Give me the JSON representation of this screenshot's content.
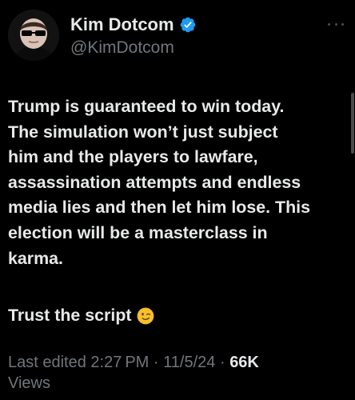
{
  "author": {
    "display_name": "Kim Dotcom",
    "handle": "@KimDotcom",
    "verified": true,
    "verified_color": "#1d9bf0"
  },
  "tweet": {
    "text": "Trump is guaranteed to win today.\nThe simulation won’t just subject\nhim and the players to lawfare,\nassassination attempts and endless\nmedia lies and then let him lose. This\nelection will be a masterclass in\nkarma.",
    "closing_line": "Trust the script",
    "closing_emoji": "winking-face-emoji"
  },
  "meta": {
    "edited_label": "Last edited 2:27 PM",
    "separator": "·",
    "date": "11/5/24",
    "views_count": "66K",
    "views_label": "Views"
  },
  "icons": {
    "more": "more-options-icon",
    "verified": "verified-badge-icon"
  },
  "colors": {
    "background": "#000000",
    "text_primary": "#e7e9ea",
    "text_secondary": "#71767b"
  }
}
